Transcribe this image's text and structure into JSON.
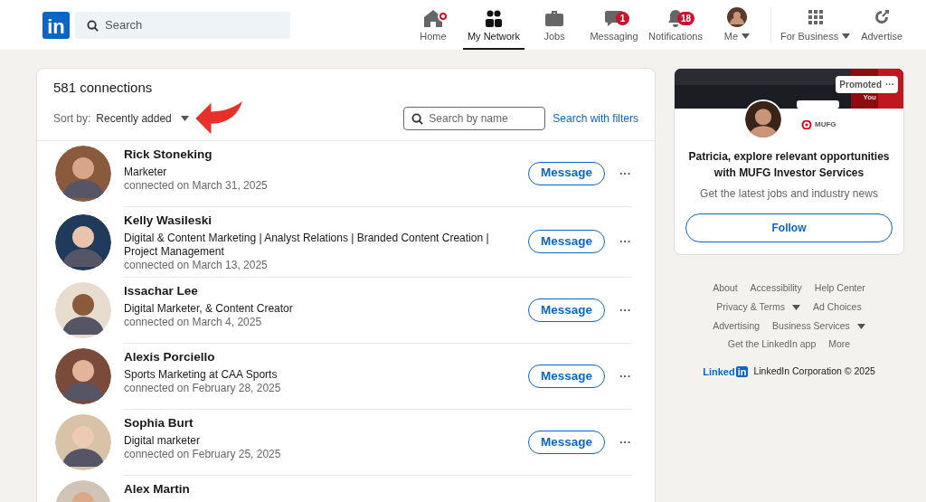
{
  "nav": {
    "logo": "in",
    "search": {
      "placeholder": "Search"
    },
    "items": [
      {
        "kind": "home",
        "label": "Home",
        "selected": false,
        "badge_dot": true
      },
      {
        "kind": "network",
        "label": "My Network",
        "selected": true
      },
      {
        "kind": "jobs",
        "label": "Jobs",
        "selected": false
      },
      {
        "kind": "messaging",
        "label": "Messaging",
        "selected": false,
        "badge": "1"
      },
      {
        "kind": "bell",
        "label": "Notifications",
        "selected": false,
        "badge": "18"
      },
      {
        "kind": "me",
        "label": "Me",
        "selected": false,
        "caret": true
      }
    ],
    "extras": [
      {
        "kind": "grid",
        "label": "For Business",
        "caret": true
      },
      {
        "kind": "advertise",
        "label": "Advertise"
      }
    ]
  },
  "connections": {
    "title": "581 connections",
    "sort_label": "Sort by:",
    "sort_value": "Recently added",
    "search": {
      "placeholder": "Search by name"
    },
    "filters_link": "Search with filters",
    "rows": [
      {
        "name": "Rick Stoneking",
        "headline": "Marketer",
        "connected": "connected on March 31, 2025",
        "button": "Message",
        "more": "···"
      },
      {
        "name": "Kelly Wasileski",
        "headline": "Digital & Content Marketing | Analyst Relations | Branded Content Creation | Project Management",
        "connected": "connected on March 13, 2025",
        "button": "Message",
        "more": "···"
      },
      {
        "name": "Issachar Lee",
        "headline": "Digital Marketer, & Content Creator",
        "connected": "connected on March 4, 2025",
        "button": "Message",
        "more": "···"
      },
      {
        "name": "Alexis Porciello",
        "headline": "Sports Marketing at CAA Sports",
        "connected": "connected on February 28, 2025",
        "button": "Message",
        "more": "···"
      },
      {
        "name": "Sophia Burt",
        "headline": "Digital marketer",
        "connected": "connected on February 25, 2025",
        "button": "Message",
        "more": "···"
      },
      {
        "name": "Alex Martin"
      }
    ]
  },
  "ad": {
    "badge": "Promoted",
    "badge_more": "···",
    "banner_text": "You",
    "logo": "MUFG",
    "title": "Patricia, explore relevant opportunities with MUFG Investor Services",
    "subtitle": "Get the latest jobs and industry news",
    "button": "Follow"
  },
  "footer": {
    "links": [
      {
        "label": "About"
      },
      {
        "label": "Accessibility"
      },
      {
        "label": "Help Center"
      },
      {
        "label": "Privacy & Terms",
        "caret": true
      },
      {
        "label": "Ad Choices"
      },
      {
        "label": "Advertising"
      },
      {
        "label": "Business Services",
        "caret": true
      },
      {
        "label": "Get the LinkedIn app"
      },
      {
        "label": "More"
      }
    ],
    "brand_word": "Linked",
    "brand_box": "in",
    "copyright": "LinkedIn Corporation © 2025"
  }
}
